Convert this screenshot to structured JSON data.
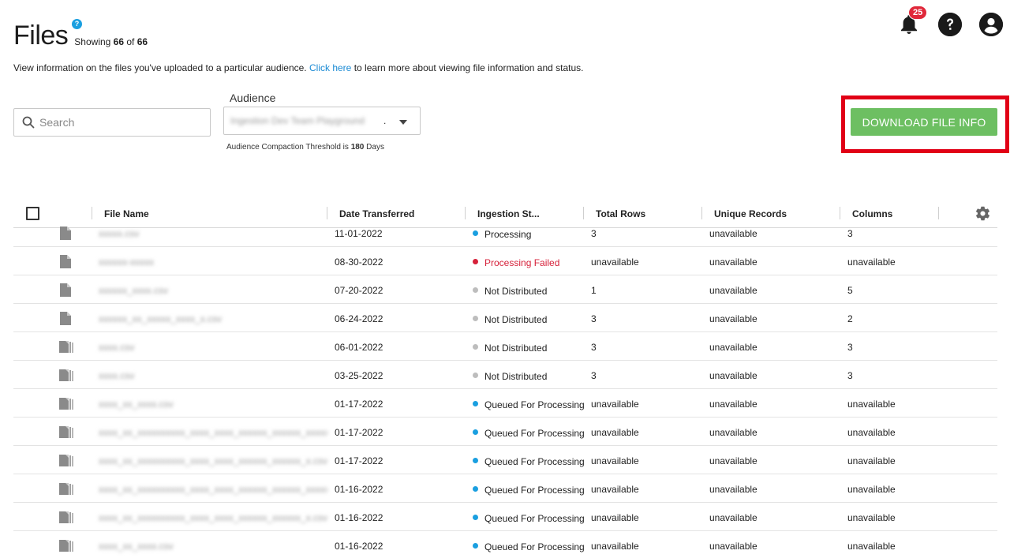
{
  "header": {
    "title": "Files",
    "help_glyph": "?",
    "showing_prefix": "Showing",
    "showing_count": "66",
    "showing_of": "of",
    "showing_total": "66",
    "notifications_count": "25",
    "help_icon": "question-circle-icon",
    "account_icon": "user-circle-icon",
    "bell_icon": "bell-icon"
  },
  "description": {
    "before_link": "View information on the files you've uploaded to a particular audience.",
    "link_text": "Click here",
    "after_link": "to learn more about viewing file information and status."
  },
  "search": {
    "placeholder": "Search",
    "value": ""
  },
  "audience": {
    "label": "Audience",
    "selected_value": "Ingestion Dev Team Playground",
    "ellipsis": ".",
    "threshold_prefix": "Audience Compaction Threshold is",
    "threshold_value": "180",
    "threshold_unit": "Days"
  },
  "actions": {
    "download_label": "DOWNLOAD FILE INFO"
  },
  "colors": {
    "accent_green": "#6dbf62",
    "highlight_red": "#e10016",
    "status_blue": "#1a9fe0",
    "status_grey": "#bdbdbd",
    "status_red": "#d6213a"
  },
  "table": {
    "columns": [
      "File Name",
      "Date Transferred",
      "Ingestion St...",
      "Total Rows",
      "Unique Records",
      "Columns"
    ],
    "rows": [
      {
        "file": "xxxxx.csv",
        "icon": "file-icon",
        "date": "11-01-2022",
        "status": "Processing",
        "status_kind": "blue",
        "total_rows": "3",
        "unique": "unavailable",
        "columns": "3"
      },
      {
        "file": "xxxxxx-xxxxx",
        "icon": "file-icon",
        "date": "08-30-2022",
        "status": "Processing Failed",
        "status_kind": "red",
        "total_rows": "unavailable",
        "unique": "unavailable",
        "columns": "unavailable"
      },
      {
        "file": "xxxxxx_xxxx.csv",
        "icon": "file-icon",
        "date": "07-20-2022",
        "status": "Not Distributed",
        "status_kind": "grey",
        "total_rows": "1",
        "unique": "unavailable",
        "columns": "5"
      },
      {
        "file": "xxxxxx_xx_xxxxx_xxxx_x.csv",
        "icon": "file-icon",
        "date": "06-24-2022",
        "status": "Not Distributed",
        "status_kind": "grey",
        "total_rows": "3",
        "unique": "unavailable",
        "columns": "2"
      },
      {
        "file": "xxxx.csv",
        "icon": "files-stack-icon",
        "date": "06-01-2022",
        "status": "Not Distributed",
        "status_kind": "grey",
        "total_rows": "3",
        "unique": "unavailable",
        "columns": "3"
      },
      {
        "file": "xxxx.csv",
        "icon": "files-stack-icon",
        "date": "03-25-2022",
        "status": "Not Distributed",
        "status_kind": "grey",
        "total_rows": "3",
        "unique": "unavailable",
        "columns": "3"
      },
      {
        "file": "xxxx_xx_xxxx.csv",
        "icon": "files-stack-icon",
        "date": "01-17-2022",
        "status": "Queued For Processing",
        "status_kind": "blue",
        "total_rows": "unavailable",
        "unique": "unavailable",
        "columns": "unavailable"
      },
      {
        "file": "xxxx_xx_xxxxxxxxxx_xxxx_xxxx_xxxxxx_xxxxxx_xxxxx.csv",
        "icon": "files-stack-icon",
        "date": "01-17-2022",
        "status": "Queued For Processing",
        "status_kind": "blue",
        "total_rows": "unavailable",
        "unique": "unavailable",
        "columns": "unavailable"
      },
      {
        "file": "xxxx_xx_xxxxxxxxxx_xxxx_xxxx_xxxxxx_xxxxxx_x.csv",
        "icon": "files-stack-icon",
        "date": "01-17-2022",
        "status": "Queued For Processing",
        "status_kind": "blue",
        "total_rows": "unavailable",
        "unique": "unavailable",
        "columns": "unavailable"
      },
      {
        "file": "xxxx_xx_xxxxxxxxxx_xxxx_xxxx_xxxxxx_xxxxxx_xxxxx.csv",
        "icon": "files-stack-icon",
        "date": "01-16-2022",
        "status": "Queued For Processing",
        "status_kind": "blue",
        "total_rows": "unavailable",
        "unique": "unavailable",
        "columns": "unavailable"
      },
      {
        "file": "xxxx_xx_xxxxxxxxxx_xxxx_xxxx_xxxxxx_xxxxxx_x.csv",
        "icon": "files-stack-icon",
        "date": "01-16-2022",
        "status": "Queued For Processing",
        "status_kind": "blue",
        "total_rows": "unavailable",
        "unique": "unavailable",
        "columns": "unavailable"
      },
      {
        "file": "xxxx_xx_xxxx.csv",
        "icon": "files-stack-icon",
        "date": "01-16-2022",
        "status": "Queued For Processing",
        "status_kind": "blue",
        "total_rows": "unavailable",
        "unique": "unavailable",
        "columns": "unavailable"
      }
    ]
  }
}
